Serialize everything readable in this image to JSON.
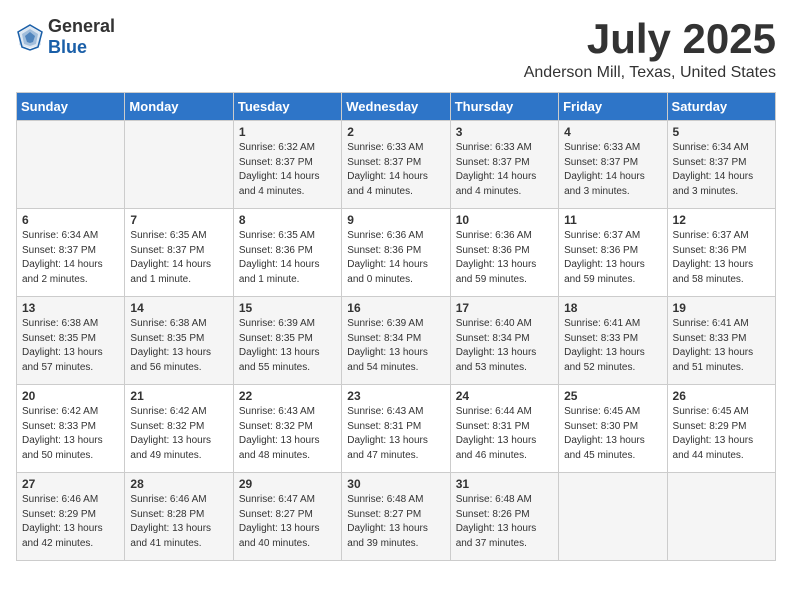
{
  "logo": {
    "text_general": "General",
    "text_blue": "Blue"
  },
  "title": {
    "month": "July 2025",
    "location": "Anderson Mill, Texas, United States"
  },
  "weekdays": [
    "Sunday",
    "Monday",
    "Tuesday",
    "Wednesday",
    "Thursday",
    "Friday",
    "Saturday"
  ],
  "weeks": [
    [
      {
        "day": "",
        "info": ""
      },
      {
        "day": "",
        "info": ""
      },
      {
        "day": "1",
        "info": "Sunrise: 6:32 AM\nSunset: 8:37 PM\nDaylight: 14 hours\nand 4 minutes."
      },
      {
        "day": "2",
        "info": "Sunrise: 6:33 AM\nSunset: 8:37 PM\nDaylight: 14 hours\nand 4 minutes."
      },
      {
        "day": "3",
        "info": "Sunrise: 6:33 AM\nSunset: 8:37 PM\nDaylight: 14 hours\nand 4 minutes."
      },
      {
        "day": "4",
        "info": "Sunrise: 6:33 AM\nSunset: 8:37 PM\nDaylight: 14 hours\nand 3 minutes."
      },
      {
        "day": "5",
        "info": "Sunrise: 6:34 AM\nSunset: 8:37 PM\nDaylight: 14 hours\nand 3 minutes."
      }
    ],
    [
      {
        "day": "6",
        "info": "Sunrise: 6:34 AM\nSunset: 8:37 PM\nDaylight: 14 hours\nand 2 minutes."
      },
      {
        "day": "7",
        "info": "Sunrise: 6:35 AM\nSunset: 8:37 PM\nDaylight: 14 hours\nand 1 minute."
      },
      {
        "day": "8",
        "info": "Sunrise: 6:35 AM\nSunset: 8:36 PM\nDaylight: 14 hours\nand 1 minute."
      },
      {
        "day": "9",
        "info": "Sunrise: 6:36 AM\nSunset: 8:36 PM\nDaylight: 14 hours\nand 0 minutes."
      },
      {
        "day": "10",
        "info": "Sunrise: 6:36 AM\nSunset: 8:36 PM\nDaylight: 13 hours\nand 59 minutes."
      },
      {
        "day": "11",
        "info": "Sunrise: 6:37 AM\nSunset: 8:36 PM\nDaylight: 13 hours\nand 59 minutes."
      },
      {
        "day": "12",
        "info": "Sunrise: 6:37 AM\nSunset: 8:36 PM\nDaylight: 13 hours\nand 58 minutes."
      }
    ],
    [
      {
        "day": "13",
        "info": "Sunrise: 6:38 AM\nSunset: 8:35 PM\nDaylight: 13 hours\nand 57 minutes."
      },
      {
        "day": "14",
        "info": "Sunrise: 6:38 AM\nSunset: 8:35 PM\nDaylight: 13 hours\nand 56 minutes."
      },
      {
        "day": "15",
        "info": "Sunrise: 6:39 AM\nSunset: 8:35 PM\nDaylight: 13 hours\nand 55 minutes."
      },
      {
        "day": "16",
        "info": "Sunrise: 6:39 AM\nSunset: 8:34 PM\nDaylight: 13 hours\nand 54 minutes."
      },
      {
        "day": "17",
        "info": "Sunrise: 6:40 AM\nSunset: 8:34 PM\nDaylight: 13 hours\nand 53 minutes."
      },
      {
        "day": "18",
        "info": "Sunrise: 6:41 AM\nSunset: 8:33 PM\nDaylight: 13 hours\nand 52 minutes."
      },
      {
        "day": "19",
        "info": "Sunrise: 6:41 AM\nSunset: 8:33 PM\nDaylight: 13 hours\nand 51 minutes."
      }
    ],
    [
      {
        "day": "20",
        "info": "Sunrise: 6:42 AM\nSunset: 8:33 PM\nDaylight: 13 hours\nand 50 minutes."
      },
      {
        "day": "21",
        "info": "Sunrise: 6:42 AM\nSunset: 8:32 PM\nDaylight: 13 hours\nand 49 minutes."
      },
      {
        "day": "22",
        "info": "Sunrise: 6:43 AM\nSunset: 8:32 PM\nDaylight: 13 hours\nand 48 minutes."
      },
      {
        "day": "23",
        "info": "Sunrise: 6:43 AM\nSunset: 8:31 PM\nDaylight: 13 hours\nand 47 minutes."
      },
      {
        "day": "24",
        "info": "Sunrise: 6:44 AM\nSunset: 8:31 PM\nDaylight: 13 hours\nand 46 minutes."
      },
      {
        "day": "25",
        "info": "Sunrise: 6:45 AM\nSunset: 8:30 PM\nDaylight: 13 hours\nand 45 minutes."
      },
      {
        "day": "26",
        "info": "Sunrise: 6:45 AM\nSunset: 8:29 PM\nDaylight: 13 hours\nand 44 minutes."
      }
    ],
    [
      {
        "day": "27",
        "info": "Sunrise: 6:46 AM\nSunset: 8:29 PM\nDaylight: 13 hours\nand 42 minutes."
      },
      {
        "day": "28",
        "info": "Sunrise: 6:46 AM\nSunset: 8:28 PM\nDaylight: 13 hours\nand 41 minutes."
      },
      {
        "day": "29",
        "info": "Sunrise: 6:47 AM\nSunset: 8:27 PM\nDaylight: 13 hours\nand 40 minutes."
      },
      {
        "day": "30",
        "info": "Sunrise: 6:48 AM\nSunset: 8:27 PM\nDaylight: 13 hours\nand 39 minutes."
      },
      {
        "day": "31",
        "info": "Sunrise: 6:48 AM\nSunset: 8:26 PM\nDaylight: 13 hours\nand 37 minutes."
      },
      {
        "day": "",
        "info": ""
      },
      {
        "day": "",
        "info": ""
      }
    ]
  ]
}
